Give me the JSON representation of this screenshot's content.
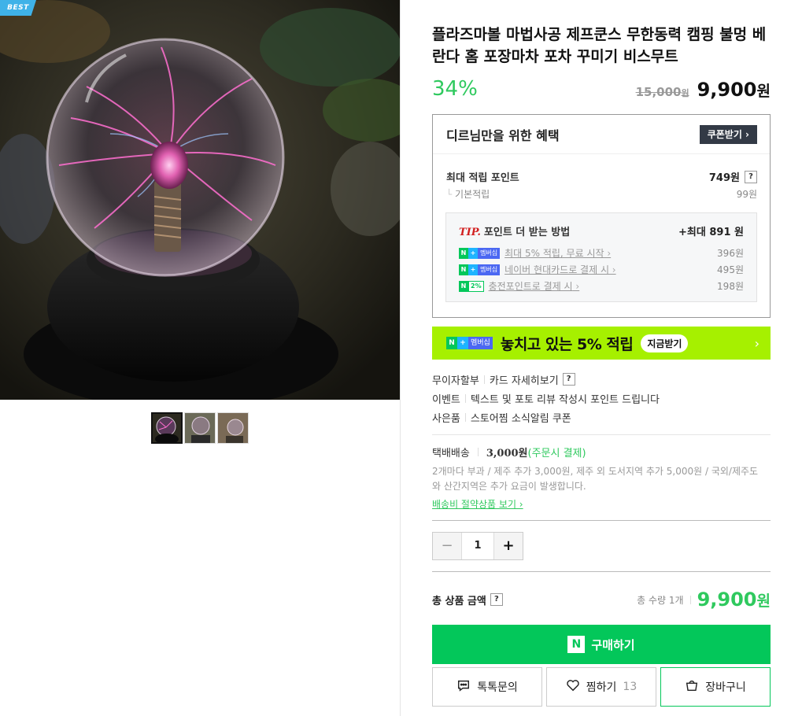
{
  "gallery": {
    "badge": "BEST",
    "thumbnail_count": 3
  },
  "product": {
    "title": "플라즈마볼 마법사공 제프쿤스 무한동력 캠핑 불멍 베란다 홈 포장마차 포차 꾸미기 비스무트",
    "discount": "34%",
    "original_price": "15,000",
    "original_unit": "원",
    "sale_price": "9,900",
    "sale_unit": "원"
  },
  "benefit": {
    "title": "디르님만을 위한 혜택",
    "coupon_button": "쿠폰받기 ›",
    "max_point_label": "최대 적립 포인트",
    "max_point_value": "749원",
    "help": "?",
    "base_label": "기본적립",
    "base_value": "99원",
    "tip": {
      "tip_word": "TIP.",
      "title": "포인트 더 받는 방법",
      "max": "+최대 891 원",
      "rows": [
        {
          "badge_n": "N",
          "badge_plus": "+",
          "badge_text": "멤버십",
          "text": "최대 5% 적립, 무료 시작",
          "value": "396원"
        },
        {
          "badge_n": "N",
          "badge_plus": "+",
          "badge_text": "멤버십",
          "text": "네이버 현대카드로 결제 시",
          "value": "495원"
        },
        {
          "badge_n": "N",
          "badge_text": "2%",
          "text": "충전포인트로 결제 시",
          "value": "198원"
        }
      ]
    }
  },
  "banner": {
    "badge_n": "N",
    "badge_plus": "+",
    "badge_text": "멤버십",
    "text": "놓치고 있는 5% 적립",
    "button": "지금받기",
    "chevron": "›"
  },
  "info": [
    {
      "key": "무이자할부",
      "value": "카드 자세히보기",
      "help": "?"
    },
    {
      "key": "이벤트",
      "value": "텍스트 및 포토 리뷰 작성시 포인트 드립니다"
    },
    {
      "key": "사은품",
      "value": "스토어찜 소식알림 쿠폰"
    }
  ],
  "shipping": {
    "method": "택배배송",
    "fee": "3,000원",
    "condition": "(주문시 결제)",
    "description": "2개마다 부과 / 제주 추가 3,000원, 제주 외 도서지역 추가 5,000원 / 국외/제주도와 산간지역은 추가 요금이 발생합니다.",
    "link": "배송비 절약상품 보기 ›"
  },
  "quantity": {
    "minus": "−",
    "value": "1",
    "plus": "+"
  },
  "total": {
    "label": "총 상품 금액",
    "help": "?",
    "count": "총 수량 1개",
    "price": "9,900",
    "unit": "원"
  },
  "actions": {
    "buy_logo": "N",
    "buy": "구매하기",
    "talk": "톡톡문의",
    "wish": "찜하기",
    "wish_count": "13",
    "cart": "장바구니"
  },
  "colors": {
    "naver_green": "#03c75a",
    "discount_green": "#2fc95e",
    "banner_lime": "#a6f000",
    "best_badge": "#3fb2e8"
  },
  "icons": [
    "chat-icon",
    "heart-icon",
    "cart-icon"
  ]
}
